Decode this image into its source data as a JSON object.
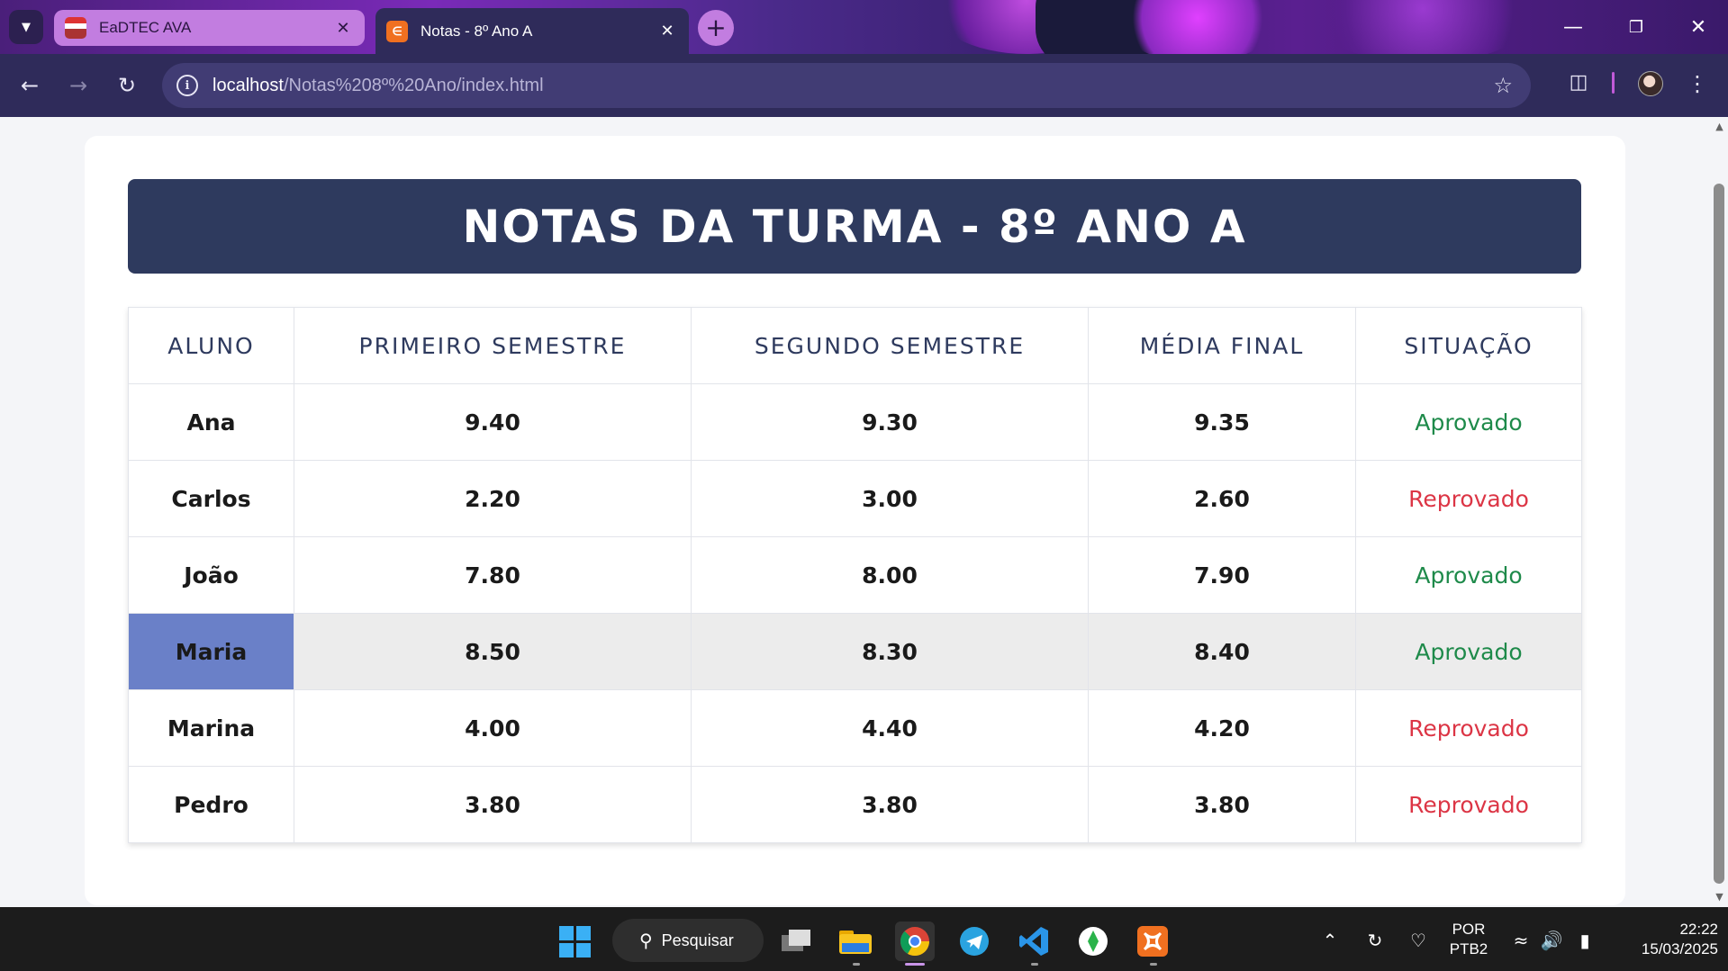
{
  "browser": {
    "tabs": [
      {
        "title": "EaDTEC AVA",
        "active": false
      },
      {
        "title": "Notas - 8º Ano A",
        "active": true
      }
    ],
    "url_host": "localhost",
    "url_path": "/Notas%208º%20Ano/index.html",
    "icons": {
      "tab_menu": "chevron-down-icon",
      "close": "close-icon",
      "new_tab": "plus-icon",
      "back": "arrow-left-icon",
      "forward": "arrow-right-icon",
      "reload": "reload-icon",
      "site_info": "info-icon",
      "bookmark": "star-icon",
      "extensions": "puzzle-icon",
      "menu": "kebab-icon"
    }
  },
  "page": {
    "title": "NOTAS DA TURMA - 8º ANO A",
    "table": {
      "headers": [
        "ALUNO",
        "PRIMEIRO SEMESTRE",
        "SEGUNDO SEMESTRE",
        "MÉDIA FINAL",
        "SITUAÇÃO"
      ],
      "rows": [
        {
          "aluno": "Ana",
          "s1": "9.40",
          "s2": "9.30",
          "media": "9.35",
          "situacao": "Aprovado"
        },
        {
          "aluno": "Carlos",
          "s1": "2.20",
          "s2": "3.00",
          "media": "2.60",
          "situacao": "Reprovado"
        },
        {
          "aluno": "João",
          "s1": "7.80",
          "s2": "8.00",
          "media": "7.90",
          "situacao": "Aprovado"
        },
        {
          "aluno": "Maria",
          "s1": "8.50",
          "s2": "8.30",
          "media": "8.40",
          "situacao": "Aprovado"
        },
        {
          "aluno": "Marina",
          "s1": "4.00",
          "s2": "4.40",
          "media": "4.20",
          "situacao": "Reprovado"
        },
        {
          "aluno": "Pedro",
          "s1": "3.80",
          "s2": "3.80",
          "media": "3.80",
          "situacao": "Reprovado"
        }
      ],
      "hovered_row": "Maria"
    },
    "colors": {
      "banner": "#2e3a5e",
      "approved": "#1e8a4a",
      "failed": "#dc3545",
      "hover_name": "#6a80c8",
      "hover_row": "#ececec"
    }
  },
  "taskbar": {
    "search_label": "Pesquisar",
    "language": "POR",
    "keyboard": "PTB2",
    "time": "22:22",
    "date": "15/03/2025"
  }
}
